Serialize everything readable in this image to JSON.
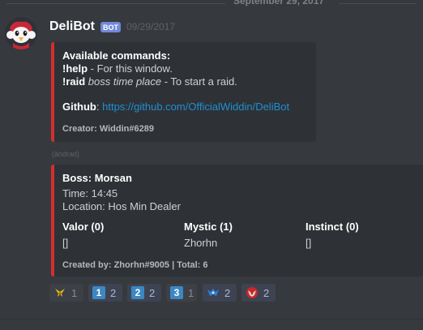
{
  "divider": {
    "date": "September 29, 2017"
  },
  "message": {
    "username": "DeliBot",
    "bot_tag": "BOT",
    "timestamp": "09/29/2017",
    "edited": "(ändrad)"
  },
  "embed1": {
    "title": "Available commands:",
    "help_cmd": "!help",
    "help_desc": " - For this window.",
    "raid_cmd": "!raid",
    "raid_args": " boss time place",
    "raid_desc": " - To start a raid.",
    "github_label": "Github",
    "github_sep": ": ",
    "github_link": "https://github.com/OfficialWiddin/DeliBot",
    "creator": "Creator: Widdin#6289",
    "accent": "#d32f2f"
  },
  "embed2": {
    "boss": "Boss: Morsan",
    "time": "Time: 14:45",
    "location": "Location: Hos Min Dealer",
    "teams": [
      {
        "name": "Valor (0)",
        "members": "[]"
      },
      {
        "name": "Mystic (1)",
        "members": "Zhorhn"
      },
      {
        "name": "Instinct (0)",
        "members": "[]"
      }
    ],
    "footer": "Created by: Zhorhn#9005 | Total: 6",
    "accent": "#d32f2f"
  },
  "reactions": [
    {
      "emoji": "instinct-icon",
      "count": "1"
    },
    {
      "emoji": "keycap-1",
      "label": "1",
      "count": "2"
    },
    {
      "emoji": "keycap-2",
      "label": "2",
      "count": "2"
    },
    {
      "emoji": "keycap-3",
      "label": "3",
      "count": "1"
    },
    {
      "emoji": "mystic-icon",
      "count": "2"
    },
    {
      "emoji": "valor-icon",
      "count": "2"
    }
  ],
  "colors": {
    "background": "#36393e",
    "embed_bg": "#2e3136",
    "bot_tag": "#7289da",
    "link": "#1e90d2",
    "keycap": "#3b88c3"
  }
}
